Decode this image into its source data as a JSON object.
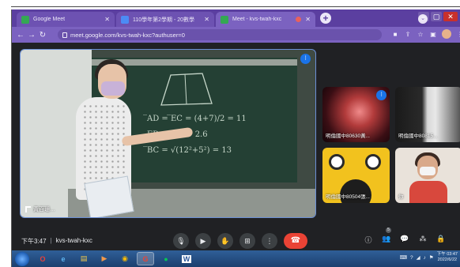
{
  "browser": {
    "tabs": [
      {
        "title": "Google Meet",
        "active": false
      },
      {
        "title": "110學年第2學期 - 20數學",
        "active": false
      },
      {
        "title": "Meet - kvs-twah-kxc",
        "active": true
      }
    ],
    "url": "meet.google.com/kvs-twah-kxc?authuser=0"
  },
  "meeting": {
    "time": "下午3:47",
    "separator": "|",
    "code": "kvs-twah-kxc",
    "main_tile_label": "黃百珊…",
    "participants_count": "5"
  },
  "board": {
    "line1": "̅AD = ̅EC = (4+7)/2 = 11",
    "line2": "ED = 1.4 + 2.6",
    "line3": "̅BC = √(12²+5²) = 13"
  },
  "tiles": [
    {
      "name": "明倫國中80630黃..."
    },
    {
      "name": "明倫國中80815..."
    },
    {
      "name": "明倫國中80504張..."
    },
    {
      "name": "你"
    }
  ],
  "taskbar": {
    "apps": [
      "e",
      "W"
    ],
    "clock_time": "下午 03:47",
    "clock_date": "2022/6/22"
  },
  "colors": {
    "tabstrip": "#5b3fa0",
    "toolbar": "#7b62c0",
    "meet_bg": "#202124",
    "end_call": "#ea4335",
    "speaking": "#1a73e8"
  }
}
